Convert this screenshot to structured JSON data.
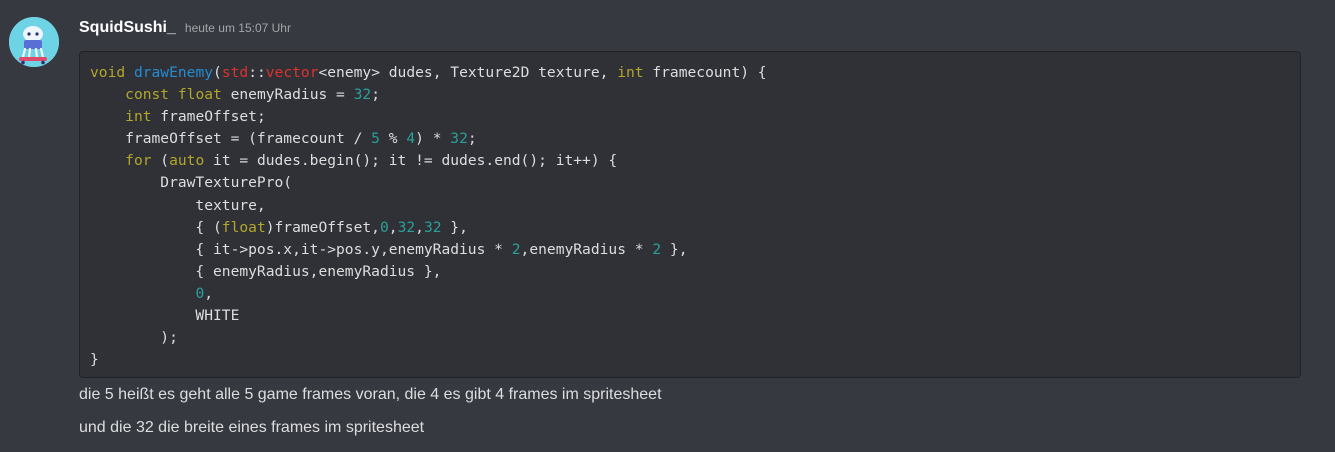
{
  "message": {
    "author": "SquidSushi_",
    "timestamp": "heute um 15:07 Uhr",
    "code_lines": [
      [
        {
          "t": "void",
          "c": "kw"
        },
        {
          "t": " "
        },
        {
          "t": "drawEnemy",
          "c": "fn"
        },
        {
          "t": "("
        },
        {
          "t": "std",
          "c": "ns"
        },
        {
          "t": "::"
        },
        {
          "t": "vector",
          "c": "ns"
        },
        {
          "t": "<enemy> dudes, Texture2D texture, "
        },
        {
          "t": "int",
          "c": "kw"
        },
        {
          "t": " framecount) {"
        }
      ],
      [
        {
          "t": "    "
        },
        {
          "t": "const",
          "c": "kw"
        },
        {
          "t": " "
        },
        {
          "t": "float",
          "c": "kw"
        },
        {
          "t": " enemyRadius = "
        },
        {
          "t": "32",
          "c": "num"
        },
        {
          "t": ";"
        }
      ],
      [
        {
          "t": "    "
        },
        {
          "t": "int",
          "c": "kw"
        },
        {
          "t": " frameOffset;"
        }
      ],
      [
        {
          "t": "    frameOffset = (framecount / "
        },
        {
          "t": "5",
          "c": "num"
        },
        {
          "t": " % "
        },
        {
          "t": "4",
          "c": "num"
        },
        {
          "t": ") * "
        },
        {
          "t": "32",
          "c": "num"
        },
        {
          "t": ";"
        }
      ],
      [
        {
          "t": "    "
        },
        {
          "t": "for",
          "c": "kw"
        },
        {
          "t": " ("
        },
        {
          "t": "auto",
          "c": "kw"
        },
        {
          "t": " it = dudes.begin(); it != dudes.end(); it++) {"
        }
      ],
      [
        {
          "t": "        DrawTexturePro("
        }
      ],
      [
        {
          "t": "            texture,"
        }
      ],
      [
        {
          "t": "            { ("
        },
        {
          "t": "float",
          "c": "kw"
        },
        {
          "t": ")frameOffset,"
        },
        {
          "t": "0",
          "c": "num"
        },
        {
          "t": ","
        },
        {
          "t": "32",
          "c": "num"
        },
        {
          "t": ","
        },
        {
          "t": "32",
          "c": "num"
        },
        {
          "t": " },"
        }
      ],
      [
        {
          "t": "            { it->pos.x,it->pos.y,enemyRadius * "
        },
        {
          "t": "2",
          "c": "num"
        },
        {
          "t": ",enemyRadius * "
        },
        {
          "t": "2",
          "c": "num"
        },
        {
          "t": " },"
        }
      ],
      [
        {
          "t": "            { enemyRadius,enemyRadius },"
        }
      ],
      [
        {
          "t": "            "
        },
        {
          "t": "0",
          "c": "num"
        },
        {
          "t": ","
        }
      ],
      [
        {
          "t": "            WHITE"
        }
      ],
      [
        {
          "t": "        );"
        }
      ],
      [
        {
          "t": "}"
        }
      ]
    ],
    "text_lines": [
      "die 5 heißt es geht alle 5 game frames voran, die 4 es gibt 4 frames im spritesheet",
      "und die 32 die breite eines frames im spritesheet"
    ]
  }
}
